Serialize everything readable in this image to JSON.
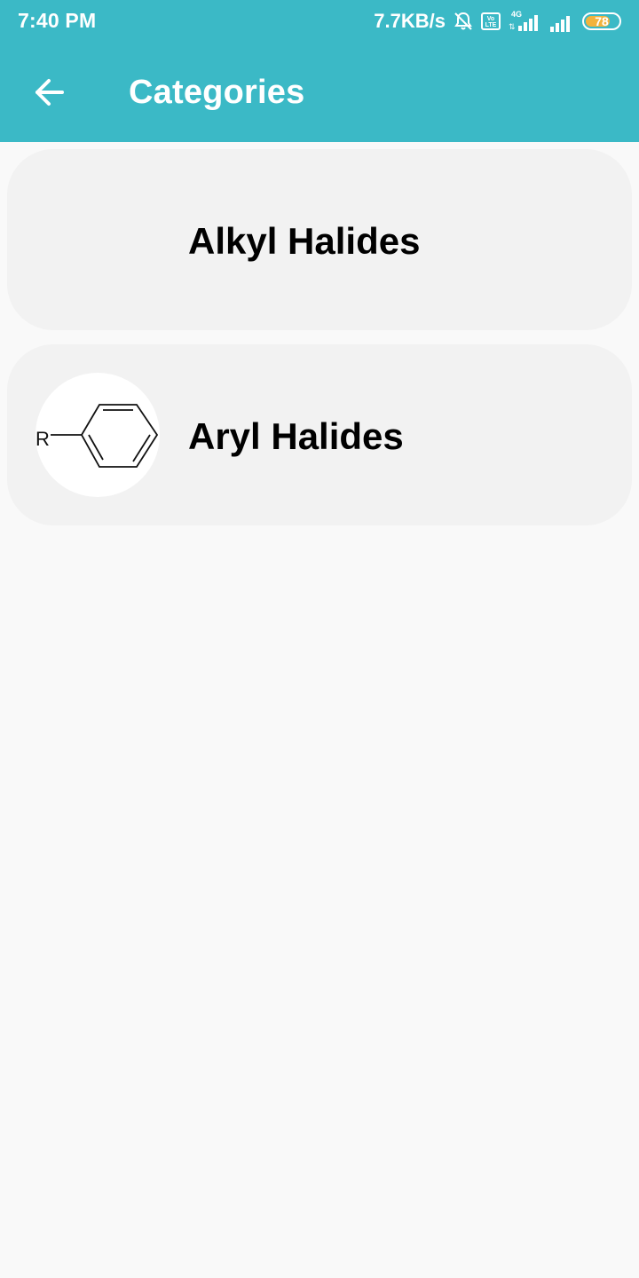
{
  "status_bar": {
    "time": "7:40 PM",
    "net_speed": "7.7KB/s",
    "volte_label": "Vo LTE",
    "network_type": "4G",
    "battery_level": "78",
    "battery_percent": 78,
    "icons": [
      "alarm-off-icon",
      "volte-icon",
      "signal-4g-icon",
      "signal-icon",
      "battery-icon"
    ]
  },
  "app_bar": {
    "title": "Categories",
    "back_icon": "back-arrow-icon",
    "color": "#3bb9c6"
  },
  "categories": [
    {
      "label": "Alkyl Halides",
      "thumbnail": ""
    },
    {
      "label": "Aryl Halides",
      "thumbnail": "benzene-ring-structure",
      "thumbnail_text": "R"
    }
  ],
  "colors": {
    "accent": "#3bb9c6",
    "card_background": "#f2f2f2",
    "page_background": "#f9f9f9"
  }
}
